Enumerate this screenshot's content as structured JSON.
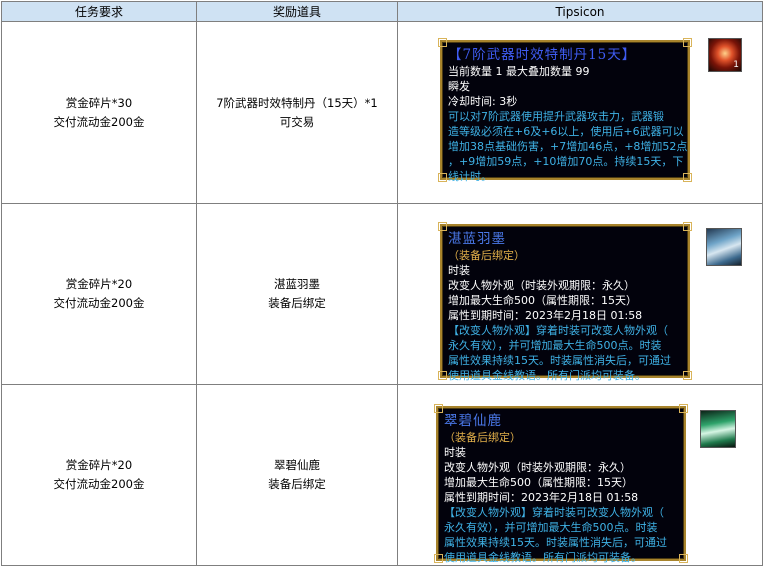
{
  "headers": [
    "任务要求",
    "奖励道具",
    "Tipsicon"
  ],
  "rows": [
    {
      "requirement": [
        "赏金碎片*30",
        "交付流动金200金"
      ],
      "reward": [
        "7阶武器时效特制丹（15天）*1",
        "可交易"
      ],
      "tip": {
        "title": "【7阶武器时效特制丹15天】",
        "title_color": "#3f5cf2",
        "lines": [
          "当前数量 1  最大叠加数量 99",
          "瞬发",
          "冷却时间:   3秒"
        ],
        "desc": [
          "可以对7阶武器使用提升武器攻击力，武器锻",
          "造等级必须在+6及+6以上，使用后+6武器可以",
          "增加38点基础伤害，+7增加46点，+8增加52点",
          "，+9增加59点，+10增加70点。持续15天，下",
          "线计时。"
        ],
        "icon": "red-gem-icon",
        "icon_count": "1"
      }
    },
    {
      "requirement": [
        "赏金碎片*20",
        "交付流动金200金"
      ],
      "reward": [
        "湛蓝羽墨",
        "装备后绑定"
      ],
      "tip": {
        "title": "湛蓝羽墨",
        "title_color": "#4a78e8",
        "bind": "（装备后绑定）",
        "lines": [
          "时装",
          "改变人物外观（时装外观期限：永久）",
          "增加最大生命500（属性期限：15天）",
          "属性到期时间：2023年2月18日 01:58"
        ],
        "desc": [
          "【改变人物外观】穿着时装可改变人物外观（",
          "永久有效），并可增加最大生命500点。时装",
          "属性效果持续15天。时装属性消失后，可通过",
          "使用道具金线教语。所有门派均可装备。"
        ],
        "icon": "blue-costume-icon"
      }
    },
    {
      "requirement": [
        "赏金碎片*20",
        "交付流动金200金"
      ],
      "reward": [
        "翠碧仙鹿",
        "装备后绑定"
      ],
      "tip": {
        "title": "翠碧仙鹿",
        "title_color": "#4a78e8",
        "bind": "（装备后绑定）",
        "lines": [
          "时装",
          "改变人物外观（时装外观期限：永久）",
          "增加最大生命500（属性期限：15天）",
          "属性到期时间：2023年2月18日 01:58"
        ],
        "desc": [
          "【改变人物外观】穿着时装可改变人物外观（",
          "永久有效），并可增加最大生命500点。时装",
          "属性效果持续15天。时装属性消失后，可通过",
          "使用道具金线教语。所有门派均可装备。"
        ],
        "icon": "green-costume-icon"
      }
    }
  ]
}
